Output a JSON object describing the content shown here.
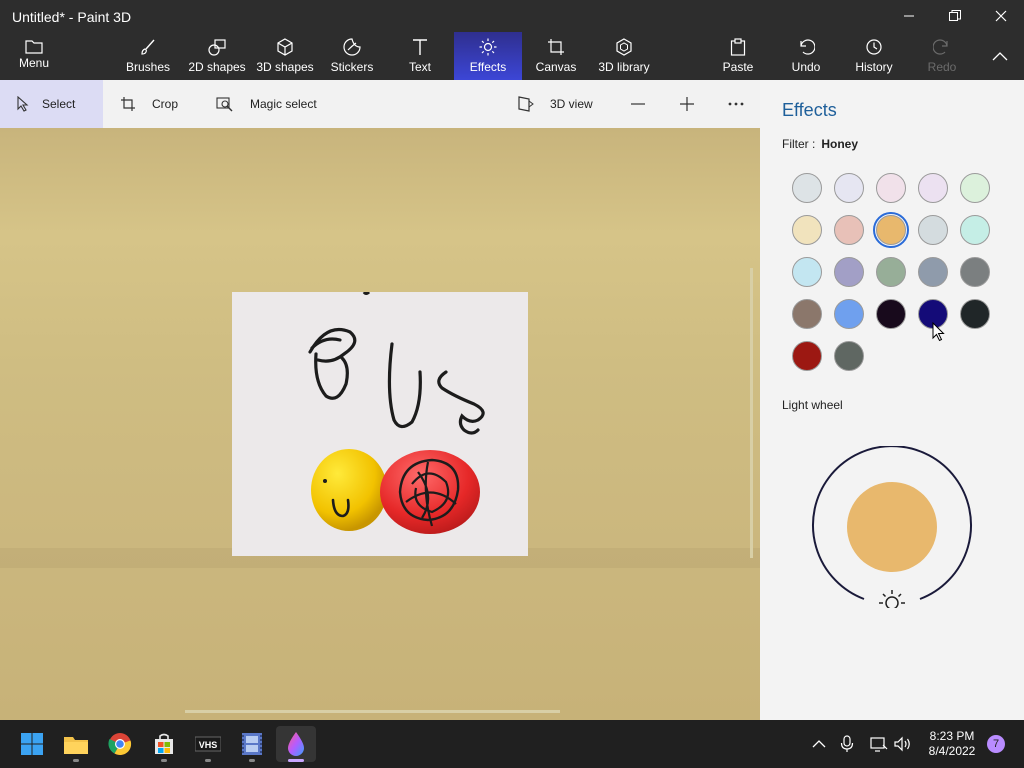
{
  "window": {
    "title": "Untitled* - Paint 3D"
  },
  "ribbon": {
    "menu": "Menu",
    "tools": [
      {
        "id": "brushes",
        "label": "Brushes"
      },
      {
        "id": "2d-shapes",
        "label": "2D shapes"
      },
      {
        "id": "3d-shapes",
        "label": "3D shapes"
      },
      {
        "id": "stickers",
        "label": "Stickers"
      },
      {
        "id": "text",
        "label": "Text"
      },
      {
        "id": "effects",
        "label": "Effects",
        "active": true
      },
      {
        "id": "canvas",
        "label": "Canvas"
      },
      {
        "id": "3d-library",
        "label": "3D library"
      }
    ],
    "paste": "Paste",
    "undo": "Undo",
    "history": "History",
    "redo": "Redo"
  },
  "toolbar": {
    "select": "Select",
    "crop": "Crop",
    "magic_select": "Magic select",
    "view_3d": "3D view"
  },
  "effects_panel": {
    "title": "Effects",
    "filter_label": "Filter :",
    "filter_value": "Honey",
    "light_wheel_label": "Light wheel",
    "light_color": "#e8b86d",
    "swatches": [
      "#dde3e6",
      "#e6e6f2",
      "#f1e1ea",
      "#ece1f1",
      "#dcf1dc",
      "#f1e3bd",
      "#e8c1b8",
      "#e8b86d",
      "#d4dcdf",
      "#c5eee6",
      "#c3e6f1",
      "#a29fc6",
      "#97ae98",
      "#8f9bab",
      "#7b7f80",
      "#8b776b",
      "#6fa0ee",
      "#180a1c",
      "#140b78",
      "#202628",
      "#9c1812",
      "#5f6762"
    ],
    "selected_index": 7
  },
  "taskbar": {
    "apps": [
      "start",
      "file-explorer",
      "chrome",
      "microsoft-store",
      "vhs",
      "film",
      "paint-3d"
    ],
    "time": "8:23 PM",
    "date": "8/4/2022",
    "notifications": "7"
  }
}
